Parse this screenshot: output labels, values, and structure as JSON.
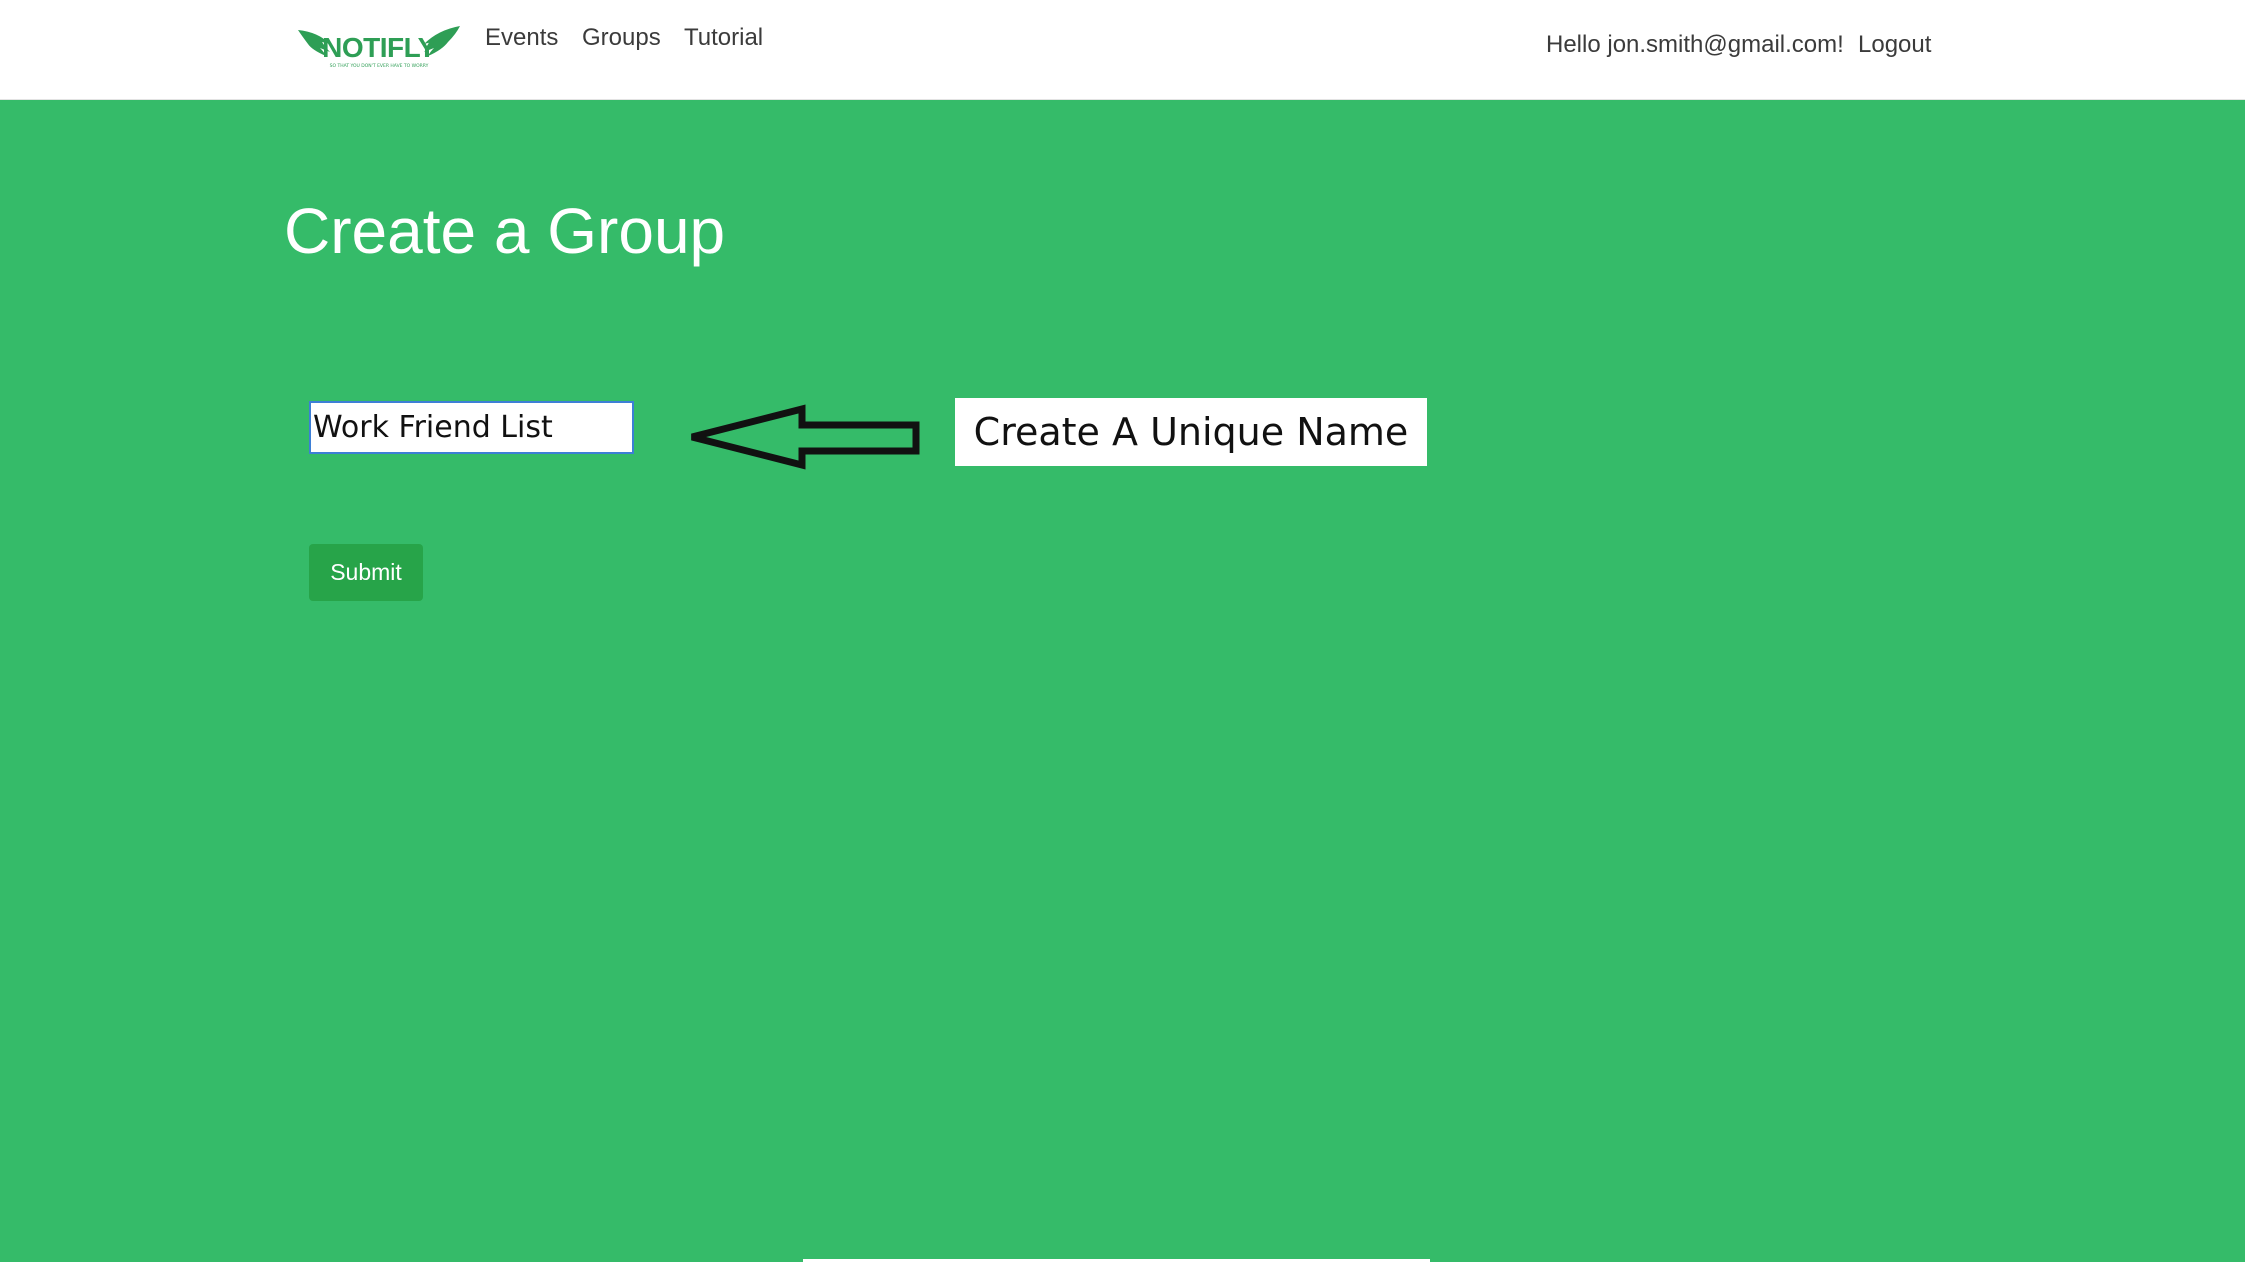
{
  "navbar": {
    "logo": {
      "name": "NOTIFLY",
      "tagline": "SO THAT YOU DON'T EVER HAVE TO WORRY",
      "color": "#2e9e55"
    },
    "links": [
      {
        "label": "Events"
      },
      {
        "label": "Groups"
      },
      {
        "label": "Tutorial"
      }
    ],
    "greeting": "Hello jon.smith@gmail.com!",
    "logout_label": "Logout"
  },
  "main": {
    "title": "Create a Group",
    "group_name_input": {
      "value": "Work Friend List",
      "placeholder": ""
    },
    "callout_text": "Create A Unique Name",
    "submit_label": "Submit"
  },
  "colors": {
    "background": "#35bb69",
    "submit_button": "#27a449",
    "input_focus_border": "#3d7fd6"
  }
}
